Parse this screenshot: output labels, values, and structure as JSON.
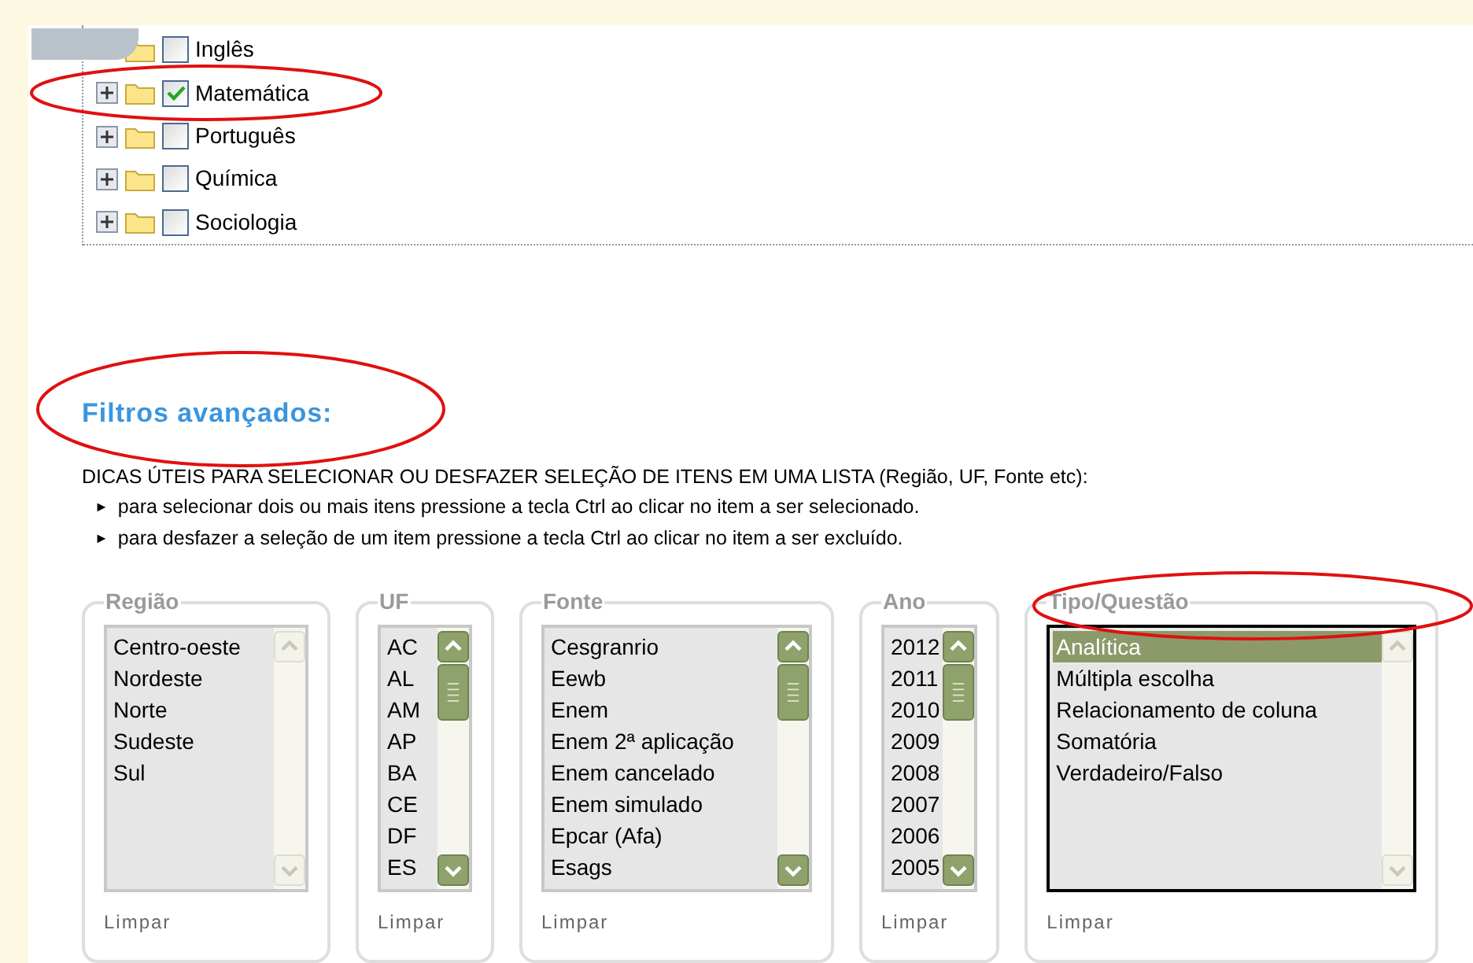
{
  "tree": [
    {
      "label": "Inglês",
      "checked": false,
      "expander": false
    },
    {
      "label": "Matemática",
      "checked": true,
      "expander": true
    },
    {
      "label": "Português",
      "checked": false,
      "expander": true
    },
    {
      "label": "Química",
      "checked": false,
      "expander": true
    },
    {
      "label": "Sociologia",
      "checked": false,
      "expander": true
    }
  ],
  "advanced": {
    "title": "Filtros avançados:",
    "tips_heading": "DICAS ÚTEIS PARA SELECIONAR OU DESFAZER SELEÇÃO DE ITENS EM UMA LISTA (Região, UF, Fonte etc):",
    "tips": [
      {
        "bullet": "►",
        "text": "para selecionar dois ou mais itens pressione a tecla Ctrl ao clicar no item a ser selecionado."
      },
      {
        "bullet": "►",
        "text": "para desfazer a seleção de um item pressione a tecla Ctrl ao clicar no item a ser excluído."
      }
    ]
  },
  "filters": [
    {
      "legend": "Região",
      "scrollable": false,
      "focused": false,
      "clear": "Limpar",
      "options": [
        {
          "label": "Centro-oeste",
          "selected": false
        },
        {
          "label": "Nordeste",
          "selected": false
        },
        {
          "label": "Norte",
          "selected": false
        },
        {
          "label": "Sudeste",
          "selected": false
        },
        {
          "label": "Sul",
          "selected": false
        }
      ]
    },
    {
      "legend": "UF",
      "scrollable": true,
      "focused": false,
      "clear": "Limpar",
      "options": [
        {
          "label": "AC",
          "selected": false
        },
        {
          "label": "AL",
          "selected": false
        },
        {
          "label": "AM",
          "selected": false
        },
        {
          "label": "AP",
          "selected": false
        },
        {
          "label": "BA",
          "selected": false
        },
        {
          "label": "CE",
          "selected": false
        },
        {
          "label": "DF",
          "selected": false
        },
        {
          "label": "ES",
          "selected": false
        }
      ]
    },
    {
      "legend": "Fonte",
      "scrollable": true,
      "focused": false,
      "clear": "Limpar",
      "options": [
        {
          "label": "Cesgranrio",
          "selected": false
        },
        {
          "label": "Eewb",
          "selected": false
        },
        {
          "label": "Enem",
          "selected": false
        },
        {
          "label": "Enem 2ª aplicação",
          "selected": false
        },
        {
          "label": "Enem cancelado",
          "selected": false
        },
        {
          "label": "Enem simulado",
          "selected": false
        },
        {
          "label": "Epcar (Afa)",
          "selected": false
        },
        {
          "label": "Esags",
          "selected": false
        }
      ]
    },
    {
      "legend": "Ano",
      "scrollable": true,
      "focused": false,
      "clear": "Limpar",
      "options": [
        {
          "label": "2012",
          "selected": false
        },
        {
          "label": "2011",
          "selected": false
        },
        {
          "label": "2010",
          "selected": false
        },
        {
          "label": "2009",
          "selected": false
        },
        {
          "label": "2008",
          "selected": false
        },
        {
          "label": "2007",
          "selected": false
        },
        {
          "label": "2006",
          "selected": false
        },
        {
          "label": "2005",
          "selected": false
        }
      ]
    },
    {
      "legend": "Tipo/Questão",
      "scrollable": false,
      "focused": true,
      "clear": "Limpar",
      "options": [
        {
          "label": "Analítica",
          "selected": true
        },
        {
          "label": "Múltipla escolha",
          "selected": false
        },
        {
          "label": "Relacionamento de coluna",
          "selected": false
        },
        {
          "label": "Somatória",
          "selected": false
        },
        {
          "label": "Verdadeiro/Falso",
          "selected": false
        }
      ]
    }
  ]
}
